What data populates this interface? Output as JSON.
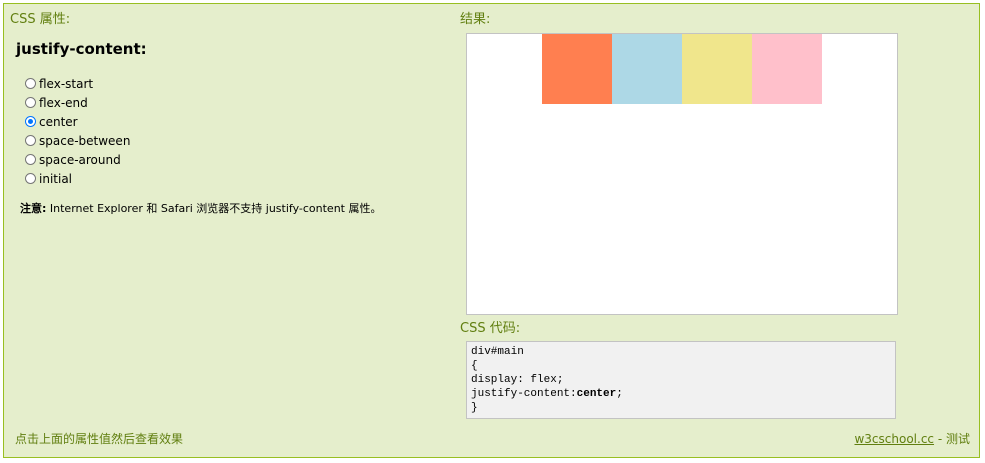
{
  "left_panel": {
    "title": "CSS 属性:",
    "property_name": "justify-content:",
    "options": [
      {
        "label": "flex-start",
        "checked": false
      },
      {
        "label": "flex-end",
        "checked": false
      },
      {
        "label": "center",
        "checked": true
      },
      {
        "label": "space-between",
        "checked": false
      },
      {
        "label": "space-around",
        "checked": false
      },
      {
        "label": "initial",
        "checked": false
      }
    ],
    "note_label": "注意:",
    "note_text": " Internet Explorer 和 Safari 浏览器不支持 justify-content 属性。"
  },
  "result": {
    "title": "结果:",
    "items": [
      {
        "color": "#ff7f50"
      },
      {
        "color": "#add8e6"
      },
      {
        "color": "#f0e68c"
      },
      {
        "color": "#ffc0cb"
      }
    ]
  },
  "code": {
    "title": "CSS 代码:",
    "lines": [
      "div#main",
      "{",
      "display: flex;"
    ],
    "prop_line_prefix": "justify-content:",
    "prop_line_value": "center",
    "prop_line_suffix": ";",
    "closing": "}"
  },
  "footer": {
    "hint": "点击上面的属性值然后查看效果",
    "link_text": "w3cschool.cc",
    "separator": " - ",
    "test_text": "测试"
  }
}
